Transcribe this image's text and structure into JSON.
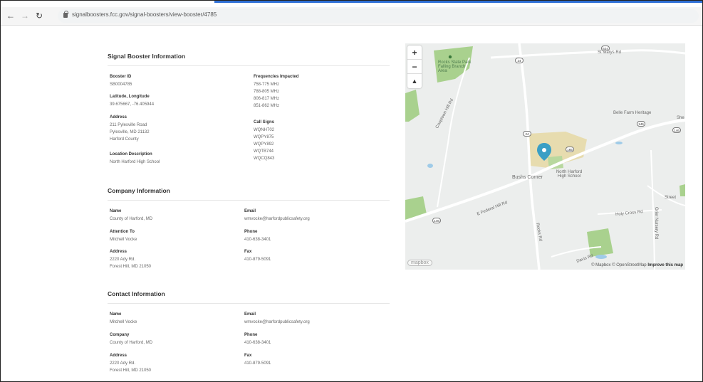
{
  "browser": {
    "url": "signalboosters.fcc.gov/signal-boosters/view-booster/4785"
  },
  "booster": {
    "title": "Signal Booster Information",
    "booster_id_label": "Booster ID",
    "booster_id": "SB0004785",
    "latlng_label": "Latitude, Longitude",
    "latlng": "39.675667, -76.405944",
    "address_label": "Address",
    "address_line1": "211 Pylesville Road",
    "address_line2": "Pylesville, MD 21132",
    "address_line3": "Harford County",
    "location_label": "Location Description",
    "location": "North Harford High School",
    "freq_label": "Frequencies Impacted",
    "frequencies": [
      "758-775 MHz",
      "788-805 MHz",
      "806-817 MHz",
      "851-862 MHz"
    ],
    "callsigns_label": "Call Signs",
    "callsigns": [
      "WQNH702",
      "WQPY875",
      "WQPY892",
      "WQTB744",
      "WQCQ843"
    ]
  },
  "company": {
    "title": "Company Information",
    "name_label": "Name",
    "name": "County of Harford, MD",
    "attention_label": "Attention To",
    "attention": "Mitchell Vocke",
    "address_label": "Address",
    "address_line1": "2220 Ady Rd.",
    "address_line2": "Forest Hill, MD 21050",
    "email_label": "Email",
    "email": "wmvocke@harfordpublicsafety.org",
    "phone_label": "Phone",
    "phone": "410-638-3401",
    "fax_label": "Fax",
    "fax": "410-879-5091"
  },
  "contact": {
    "title": "Contact Information",
    "name_label": "Name",
    "name": "Mitchell Vocke",
    "company_label": "Company",
    "company": "County of Harford, MD",
    "address_label": "Address",
    "address_line1": "2220 Ady Rd.",
    "address_line2": "Forest Hill, MD 21050",
    "email_label": "Email",
    "email": "wmvocke@harfordpublicsafety.org",
    "phone_label": "Phone",
    "phone": "410-638-3401",
    "fax_label": "Fax",
    "fax": "410-879-5091"
  },
  "map": {
    "zoom_in": "+",
    "zoom_out": "−",
    "compass": "▲",
    "labels": {
      "park": "Rocks State Park Falling Branch Area",
      "st_marys": "St Marys Rd",
      "belle_farm": "Belle Farm Heritage",
      "she": "She",
      "cooptown": "Cooptown Hill Rd",
      "bushs_corner": "Bushs Corner",
      "school": "North Harford High School",
      "federal_hill": "E Federal Hill Rd",
      "holy_cross": "Holy Cross Rd",
      "grier": "Grier Nursery Rd",
      "rocks_rd": "Rocks Rd",
      "davis": "Davis Rd",
      "street": "Street"
    },
    "shields": {
      "r624": "624",
      "r24a": "24",
      "r24b": "24",
      "r165": "165",
      "r146a": "146",
      "r146b": "146",
      "r146c": "146"
    },
    "logo": "mapbox",
    "attribution_mapbox": "© Mapbox",
    "attribution_osm": "© OpenStreetMap",
    "attribution_improve": "Improve this map",
    "colors": {
      "pin": "#3a9fc5",
      "park": "#a9d18e",
      "water": "#9fcbe8",
      "school_area": "#e7dcaf"
    }
  }
}
